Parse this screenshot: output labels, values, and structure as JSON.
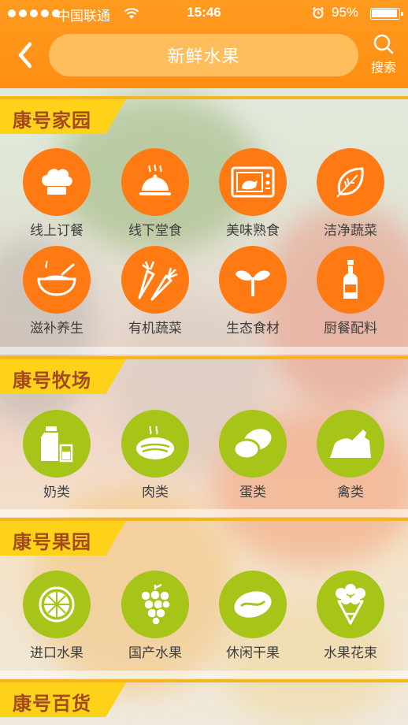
{
  "status_bar": {
    "carrier": "中国联通",
    "time": "15:46",
    "battery": "95%"
  },
  "nav": {
    "title": "新鲜水果",
    "search_label": "搜索"
  },
  "sections": [
    {
      "header": "康号家园",
      "items": [
        {
          "label": "线上订餐",
          "icon": "chef-hat-icon"
        },
        {
          "label": "线下堂食",
          "icon": "cloche-icon"
        },
        {
          "label": "美味熟食",
          "icon": "oven-icon"
        },
        {
          "label": "洁净蔬菜",
          "icon": "leaf-icon"
        },
        {
          "label": "滋补养生",
          "icon": "soup-bowl-icon"
        },
        {
          "label": "有机蔬菜",
          "icon": "carrot-icon"
        },
        {
          "label": "生态食材",
          "icon": "sprout-icon"
        },
        {
          "label": "厨餐配料",
          "icon": "bottle-icon"
        }
      ]
    },
    {
      "header": "康号牧场",
      "items": [
        {
          "label": "奶类",
          "icon": "milk-icon"
        },
        {
          "label": "肉类",
          "icon": "meat-icon"
        },
        {
          "label": "蛋类",
          "icon": "egg-icon"
        },
        {
          "label": "禽类",
          "icon": "poultry-icon"
        }
      ]
    },
    {
      "header": "康号果园",
      "items": [
        {
          "label": "进口水果",
          "icon": "citrus-icon"
        },
        {
          "label": "国产水果",
          "icon": "grapes-icon"
        },
        {
          "label": "休闲干果",
          "icon": "nut-icon"
        },
        {
          "label": "水果花束",
          "icon": "bouquet-icon"
        }
      ]
    },
    {
      "header": "康号百货",
      "items": []
    }
  ],
  "colors": {
    "nav_orange": "#ff9a1f",
    "title_pill": "#ffbd5c",
    "orange_circle": "#ff7a12",
    "green_circle": "#a7c418",
    "section_tab": "#ffd21a",
    "section_text": "#a24a1c"
  }
}
